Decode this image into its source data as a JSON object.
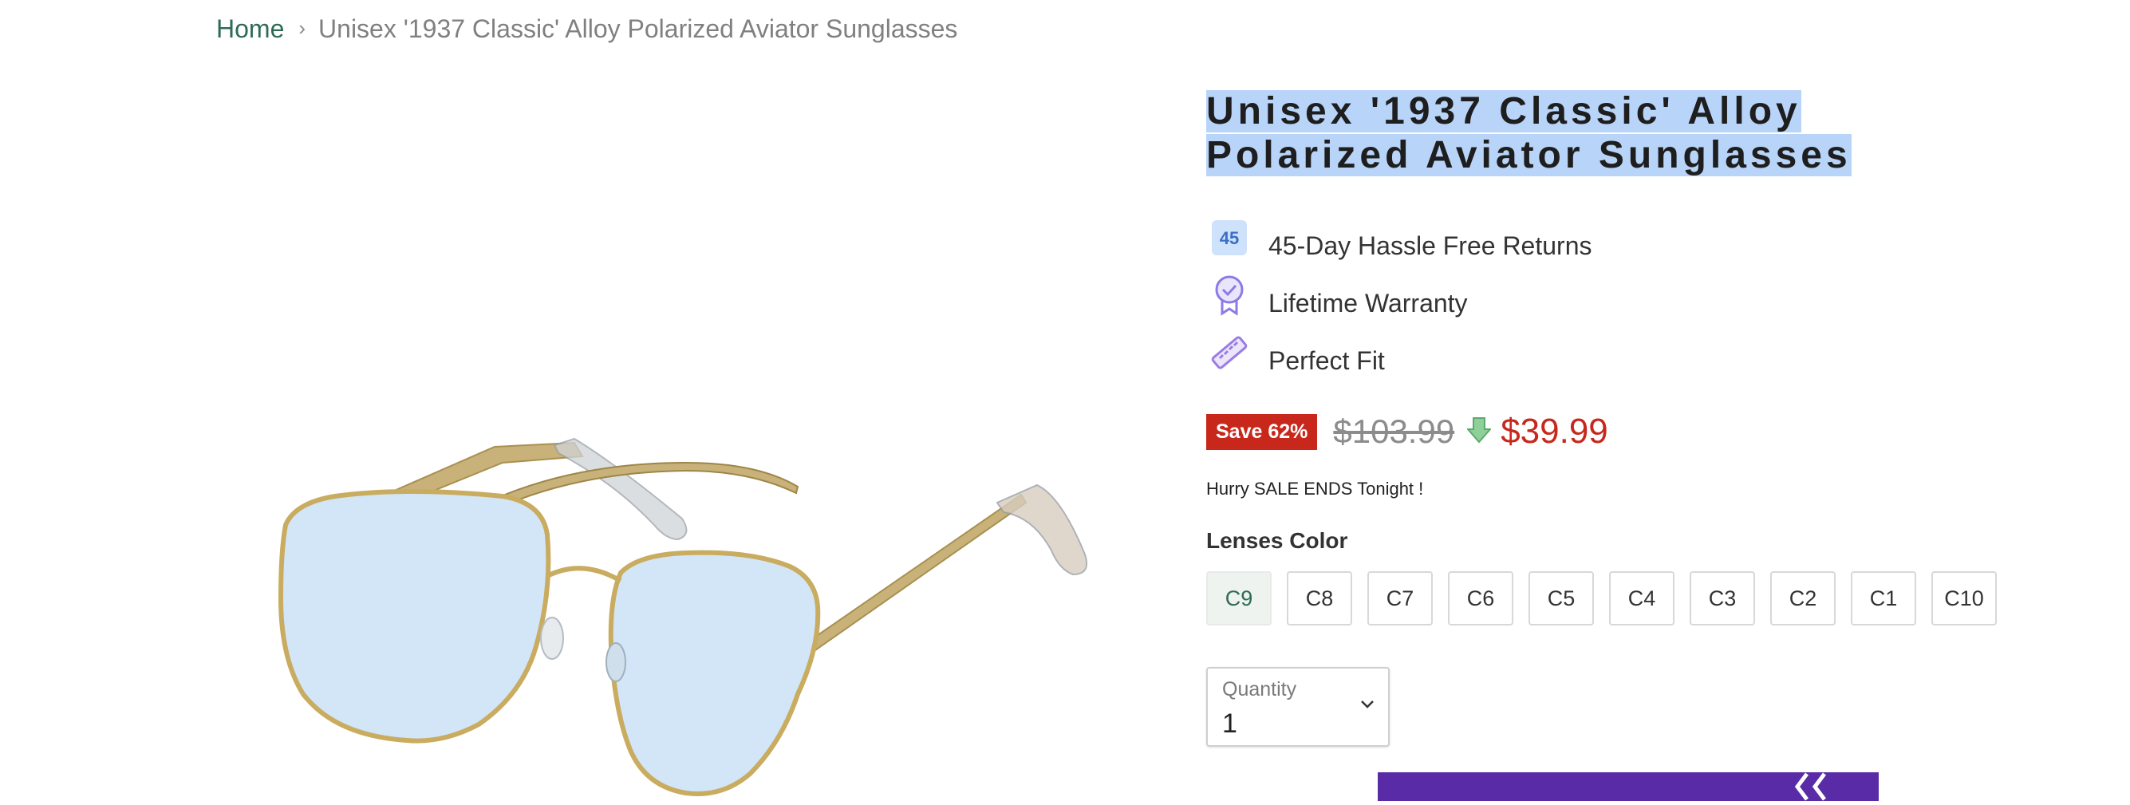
{
  "breadcrumb": {
    "home": "Home",
    "separator": "›",
    "current": "Unisex '1937 Classic' Alloy Polarized Aviator Sunglasses"
  },
  "product": {
    "image_icon": "aviator-sunglasses-image",
    "title": "Unisex '1937 Classic' Alloy Polarized Aviator Sunglasses"
  },
  "features": [
    {
      "icon": "45-day-badge-icon",
      "icon_text": "45",
      "text": "45-Day Hassle Free Returns"
    },
    {
      "icon": "warranty-ribbon-icon",
      "text": "Lifetime Warranty"
    },
    {
      "icon": "ruler-icon",
      "text": "Perfect Fit"
    }
  ],
  "pricing": {
    "save_badge": "Save 62%",
    "old_price": "$103.99",
    "new_price": "$39.99",
    "sale_color": "#c8281c"
  },
  "urgency": "Hurry SALE ENDS Tonight !",
  "lenses": {
    "label": "Lenses Color",
    "options": [
      "C9",
      "C8",
      "C7",
      "C6",
      "C5",
      "C4",
      "C3",
      "C2",
      "C1",
      "C10"
    ],
    "selected": "C9"
  },
  "quantity": {
    "label": "Quantity",
    "value": "1"
  },
  "colors": {
    "accent_green": "#2e6b57",
    "cart_purple": "#5a2ba6",
    "selection": "#b8d4f9"
  }
}
